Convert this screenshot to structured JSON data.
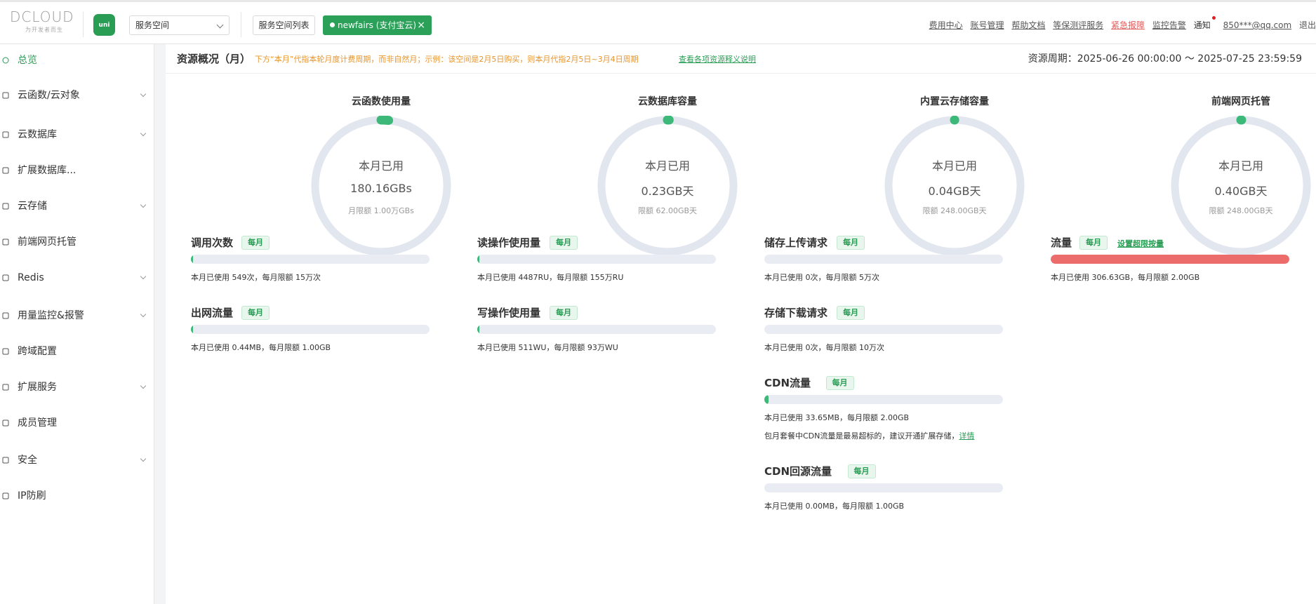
{
  "header": {
    "logo_text": "DCLOUD",
    "logo_slogan": "为开发者而生",
    "uni_label": "uni",
    "space_select_value": "服务空间",
    "space_list_label": "服务空间列表",
    "current_space": "newfairs (支付宝云)",
    "close_glyph": "×",
    "links": {
      "billing": "费用中心",
      "account": "账号管理",
      "help": "帮助文档",
      "assessment": "等保测评服务",
      "emergency": "紧急报障",
      "monitor": "监控告警",
      "notice": "通知",
      "user": "850***@qq.com",
      "logout": "退出"
    }
  },
  "sidebar": {
    "items": [
      {
        "label": "总览",
        "icon": "clock-icon",
        "expandable": false,
        "active": true
      },
      {
        "label": "云函数/云对象",
        "icon": "cloud-icon",
        "expandable": true
      },
      {
        "label": "云数据库",
        "icon": "database-icon",
        "expandable": true
      },
      {
        "label": "扩展数据库...",
        "icon": "cylinder-icon",
        "expandable": false
      },
      {
        "label": "云存储",
        "icon": "storage-icon",
        "expandable": true
      },
      {
        "label": "前端网页托管",
        "icon": "web-icon",
        "expandable": false
      },
      {
        "label": "Redis",
        "icon": "redis-icon",
        "expandable": true
      },
      {
        "label": "用量监控&报警",
        "icon": "alarm-icon",
        "expandable": true
      },
      {
        "label": "跨域配置",
        "icon": "cors-icon",
        "expandable": false
      },
      {
        "label": "扩展服务",
        "icon": "grid-icon",
        "expandable": true
      },
      {
        "label": "成员管理",
        "icon": "user-icon",
        "expandable": false
      },
      {
        "label": "安全",
        "icon": "shield-icon",
        "expandable": true
      },
      {
        "label": "IP防刷",
        "icon": "shield-check-icon",
        "expandable": false
      }
    ]
  },
  "overview": {
    "title": "资源概况（月）",
    "note": "下方“本月”代指本轮月度计费周期，而非自然月；示例：该空间是2月5日购买，则本月代指2月5日~3月4日周期",
    "link": "查看各项资源释义说明",
    "period": "资源周期：2025-06-26 00:00:00 〜 2025-07-25 23:59:59"
  },
  "gauges": [
    {
      "title": "云函数使用量",
      "label": "本月已用",
      "value": "180.16GBs",
      "limit": "月限额 1.00万GBs",
      "percent": 0.018
    },
    {
      "title": "云数据库容量",
      "label": "本月已用",
      "value": "0.23GB天",
      "limit": "限额 62.00GB天",
      "percent": 0.004
    },
    {
      "title": "内置云存储容量",
      "label": "本月已用",
      "value": "0.04GB天",
      "limit": "限额 248.00GB天",
      "percent": 0.0002
    },
    {
      "title": "前端网页托管",
      "label": "本月已用",
      "value": "0.40GB天",
      "limit": "限额 248.00GB天",
      "percent": 0.0016
    }
  ],
  "badge_label": "每月",
  "metrics": {
    "col1": [
      {
        "name": "调用次数",
        "usage": "本月已使用 549次，每月限额 15万次",
        "percent": 0.0037
      },
      {
        "name": "出网流量",
        "usage": "本月已使用 0.44MB，每月限额 1.00GB",
        "percent": 0.0004
      }
    ],
    "col2": [
      {
        "name": "读操作使用量",
        "usage": "本月已使用 4487RU，每月限额 155万RU",
        "percent": 0.0029
      },
      {
        "name": "写操作使用量",
        "usage": "本月已使用 511WU，每月限额 93万WU",
        "percent": 0.0005
      }
    ],
    "col3": [
      {
        "name": "储存上传请求",
        "usage": "本月已使用 0次，每月限额 5万次",
        "percent": 0
      },
      {
        "name": "存储下载请求",
        "usage": "本月已使用 0次，每月限额 10万次",
        "percent": 0
      },
      {
        "name": "CDN流量",
        "usage": "本月已使用 33.65MB，每月限额 2.00GB",
        "percent": 0.0164,
        "tip": "包月套餐中CDN流量是最易超标的，建议开通扩展存储，",
        "tip_link": "详情"
      },
      {
        "name": "CDN回源流量",
        "usage": "本月已使用 0.00MB，每月限额 1.00GB",
        "percent": 0
      }
    ],
    "col4": [
      {
        "name": "流量",
        "usage": "本月已使用 306.63GB，每月限额 2.00GB",
        "percent": 1,
        "extra_link": "设置超限按量"
      }
    ]
  },
  "colors": {
    "accent": "#2a9d55",
    "over": "#ec6b6b",
    "track": "#e2e7ef"
  }
}
